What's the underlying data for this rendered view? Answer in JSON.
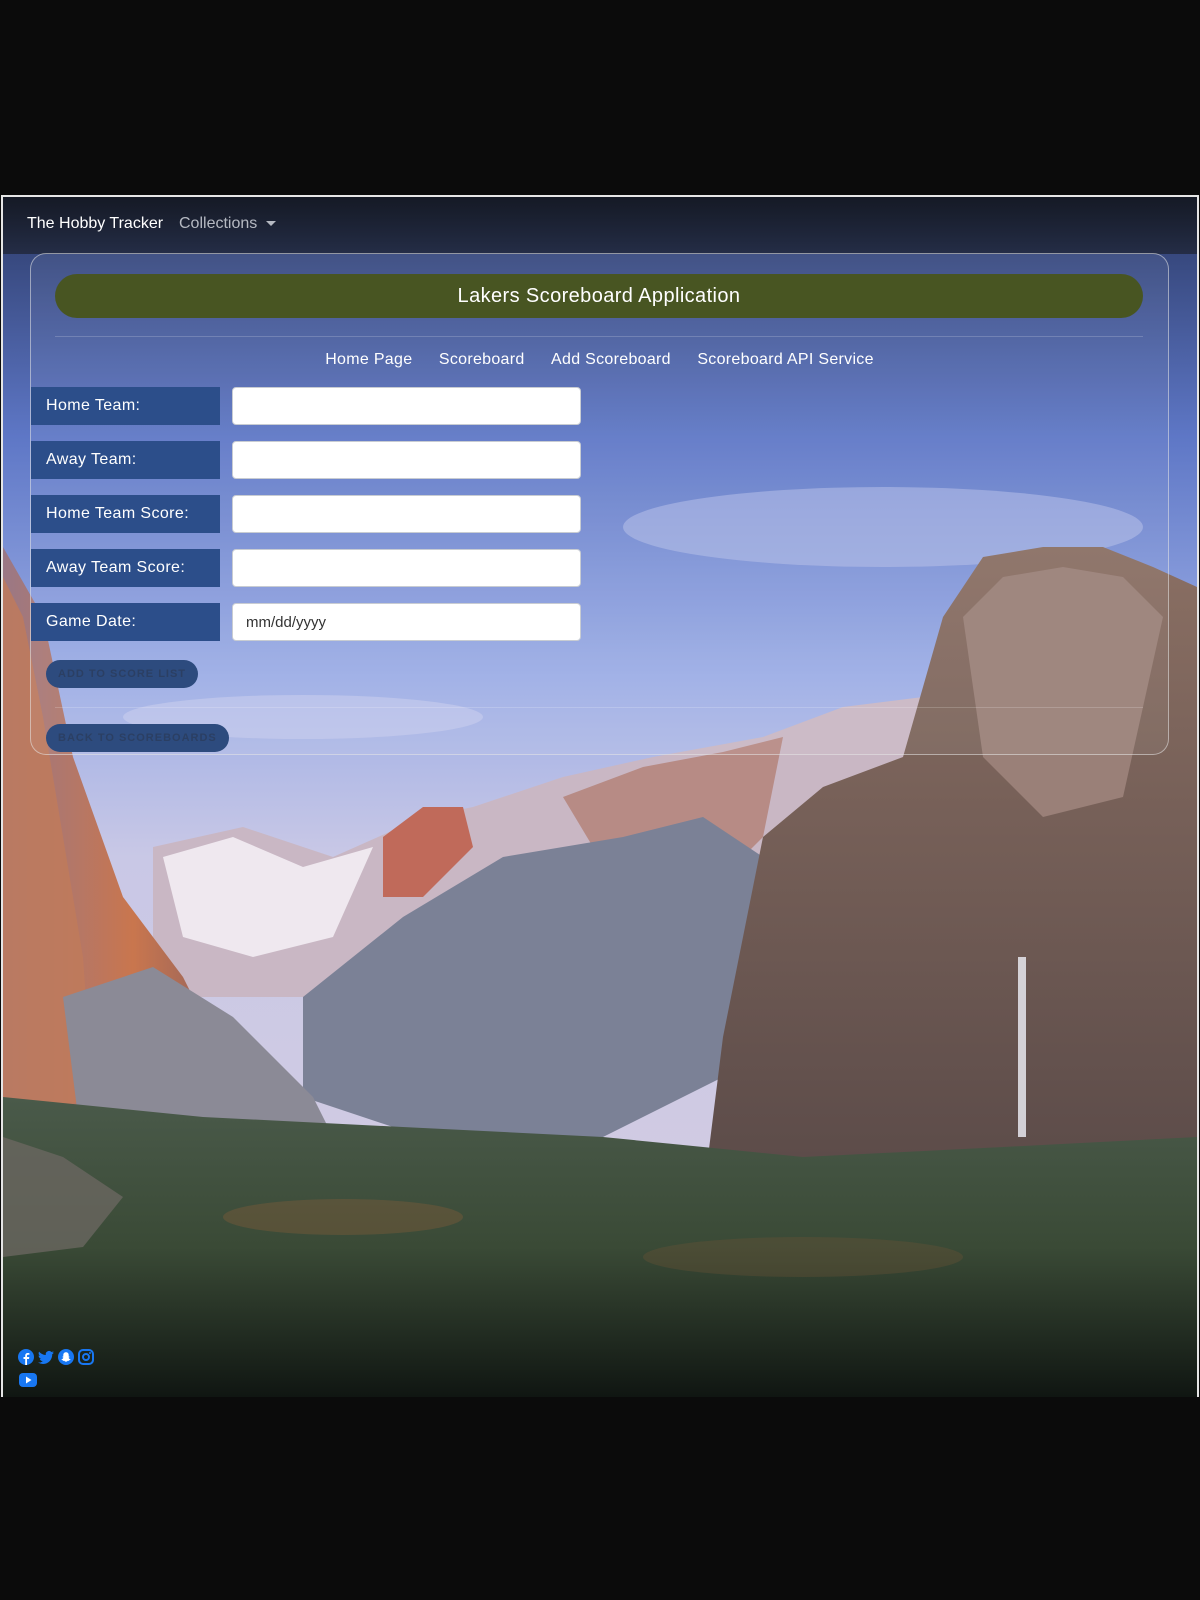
{
  "navbar": {
    "brand": "The Hobby Tracker",
    "dropdown_label": "Collections"
  },
  "card": {
    "title": "Lakers Scoreboard Application",
    "links": [
      "Home Page",
      "Scoreboard",
      "Add Scoreboard",
      "Scoreboard API Service"
    ]
  },
  "form": {
    "fields": [
      {
        "label": "Home Team:",
        "value": "",
        "placeholder": ""
      },
      {
        "label": "Away Team:",
        "value": "",
        "placeholder": ""
      },
      {
        "label": "Home Team Score:",
        "value": "",
        "placeholder": ""
      },
      {
        "label": "Away Team Score:",
        "value": "",
        "placeholder": ""
      },
      {
        "label": "Game Date:",
        "value": "",
        "placeholder": "mm/dd/yyyy"
      }
    ],
    "add_button": "ADD TO SCORE LIST",
    "back_button": "BACK TO SCOREBOARDS"
  },
  "colors": {
    "title_bar": "#485522",
    "label_bg": "#2c4e8a",
    "social_icons": "#1877f2"
  },
  "footer": {
    "social_icons": [
      "facebook-icon",
      "twitter-icon",
      "snapchat-icon",
      "instagram-icon",
      "youtube-icon"
    ]
  }
}
